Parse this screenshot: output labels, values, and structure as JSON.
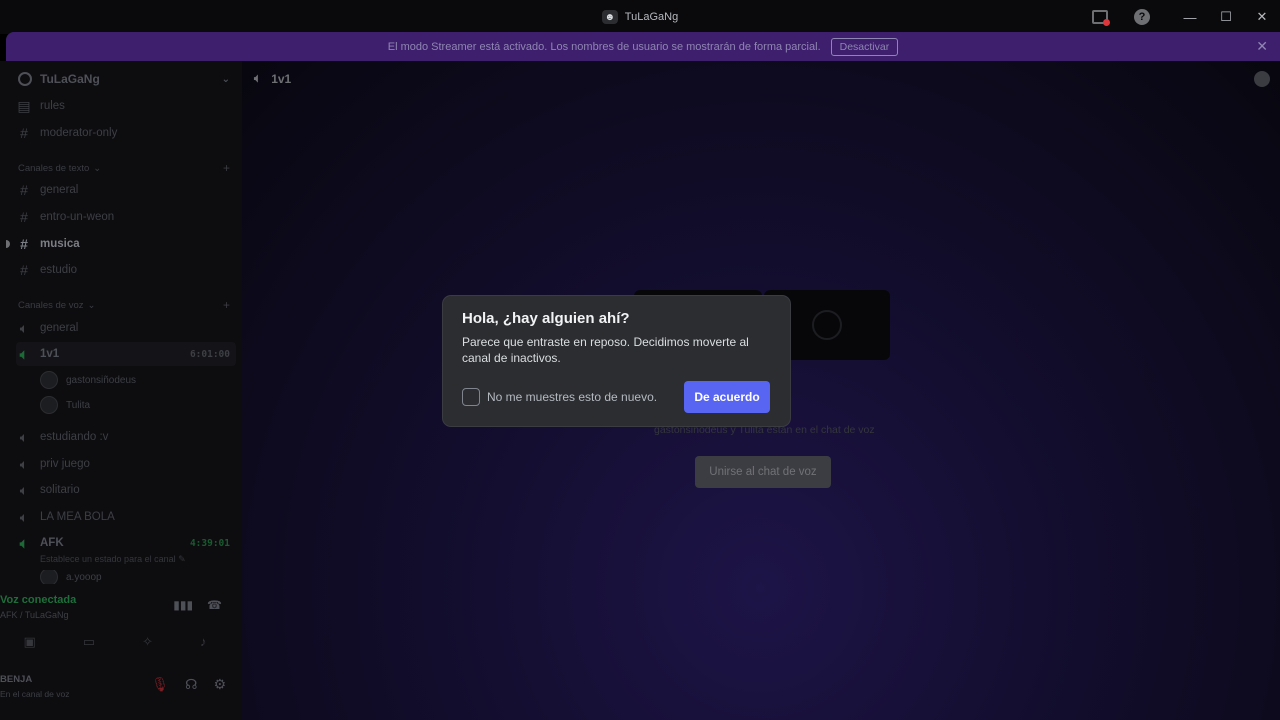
{
  "window": {
    "title": "TuLaGaNg",
    "icons": [
      "inbox-icon",
      "help-icon",
      "minimize-icon",
      "maximize-icon",
      "close-icon"
    ]
  },
  "banner": {
    "message": "El modo Streamer está activado. Los nombres de usuario se mostrarán de forma parcial.",
    "button": "Desactivar",
    "color": "#3e1f6e"
  },
  "server": {
    "name": "TuLaGaNg"
  },
  "sidebar": {
    "top_channels": [
      {
        "name": "rules",
        "icon": "rules-icon"
      },
      {
        "name": "moderator-only",
        "icon": "hash-icon"
      }
    ],
    "text_category": "Canales de texto",
    "text_channels": [
      {
        "name": "general"
      },
      {
        "name": "entro-un-weon"
      },
      {
        "name": "musica"
      },
      {
        "name": "estudio"
      }
    ],
    "voice_category": "Canales de voz",
    "voice_channels": [
      {
        "name": "general"
      },
      {
        "name": "1v1",
        "timer": "6:01:00"
      },
      {
        "name": "estudiando :v"
      },
      {
        "name": "priv juego"
      },
      {
        "name": "solitario"
      },
      {
        "name": "LA MEA BOLA"
      },
      {
        "name": "AFK",
        "timer": "4:39:01"
      }
    ],
    "members_1v1": [
      "gastonsiñodeus",
      "Tulita"
    ],
    "afk_status_hint": "Establece un estado para el canal",
    "afk_member": "a.yooop"
  },
  "voice_panel": {
    "title": "Voz conectada",
    "subtitle": "AFK / TuLaGaNg"
  },
  "user_panel": {
    "name": "BENJA",
    "status": "En el canal de voz"
  },
  "main": {
    "channel_name": "1v1",
    "voice_info": "gastonsiñodeus y Tulita están en el chat de voz",
    "join_button": "Unirse al chat de voz"
  },
  "modal": {
    "title": "Hola, ¿hay alguien ahí?",
    "body": "Parece que entraste en reposo. Decidimos moverte al canal de inactivos.",
    "checkbox_label": "No me muestres esto de nuevo.",
    "checkbox_checked": false,
    "confirm_button": "De acuerdo",
    "accent": "#5865f2"
  }
}
